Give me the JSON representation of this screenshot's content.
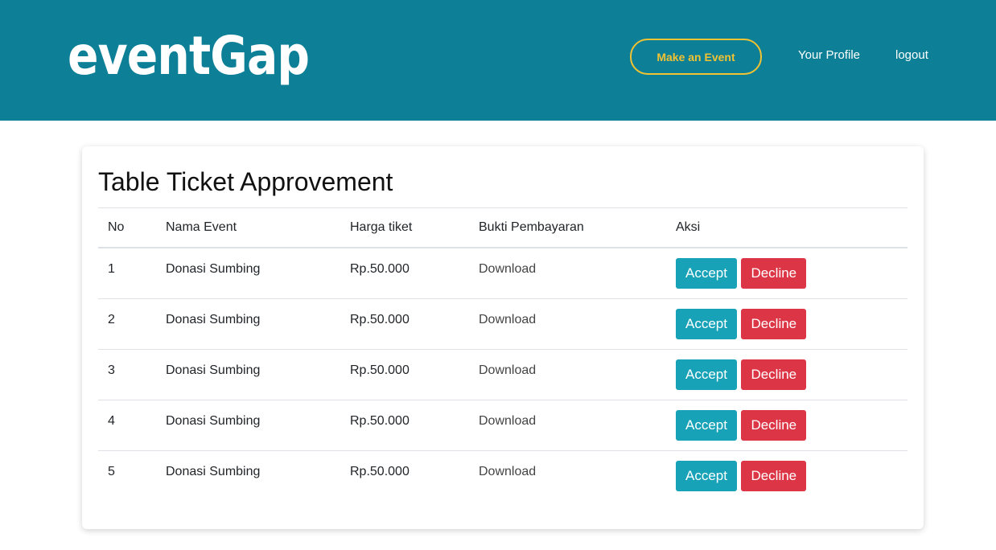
{
  "header": {
    "brand": "eventGap",
    "make_event_label": "Make an Event",
    "profile_label": "Your Profile",
    "logout_label": "logout"
  },
  "colors": {
    "nav_bg": "#0d8097",
    "accent_yellow": "#f1c232",
    "accept": "#17a2b8",
    "decline": "#dc3545"
  },
  "card": {
    "title": "Table Ticket Approvement"
  },
  "table": {
    "headers": [
      "No",
      "Nama Event",
      "Harga tiket",
      "Bukti Pembayaran",
      "Aksi"
    ],
    "rows": [
      {
        "no": "1",
        "nama": "Donasi Sumbing",
        "harga": "Rp.50.000",
        "bukti": "Download",
        "accept": "Accept",
        "decline": "Decline"
      },
      {
        "no": "2",
        "nama": "Donasi Sumbing",
        "harga": "Rp.50.000",
        "bukti": "Download",
        "accept": "Accept",
        "decline": "Decline"
      },
      {
        "no": "3",
        "nama": "Donasi Sumbing",
        "harga": "Rp.50.000",
        "bukti": "Download",
        "accept": "Accept",
        "decline": "Decline"
      },
      {
        "no": "4",
        "nama": "Donasi Sumbing",
        "harga": "Rp.50.000",
        "bukti": "Download",
        "accept": "Accept",
        "decline": "Decline"
      },
      {
        "no": "5",
        "nama": "Donasi Sumbing",
        "harga": "Rp.50.000",
        "bukti": "Download",
        "accept": "Accept",
        "decline": "Decline"
      }
    ]
  }
}
